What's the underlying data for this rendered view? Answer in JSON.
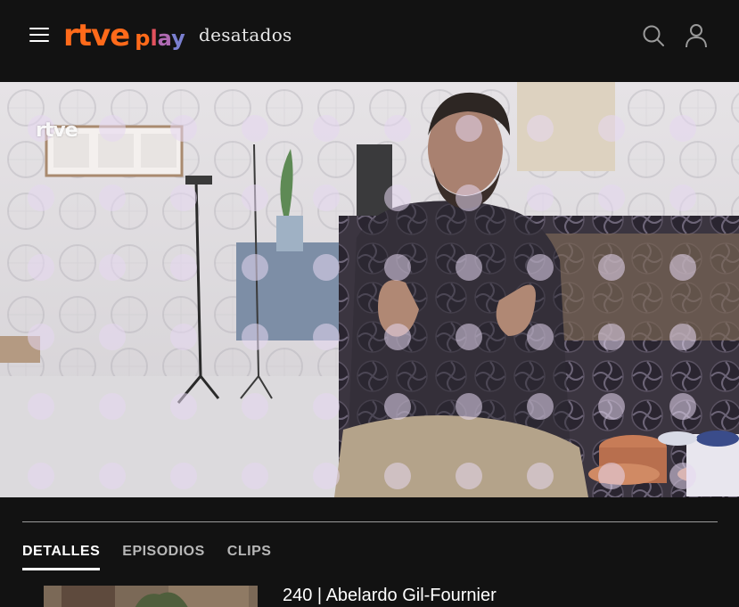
{
  "header": {
    "menu_icon": "hamburger-menu-icon",
    "logo": {
      "rtve": "rtve",
      "play": [
        "p",
        "l",
        "a",
        "y"
      ]
    },
    "section_title": "desatados",
    "search_icon": "search-icon",
    "user_icon": "user-icon"
  },
  "player": {
    "watermark": "rtve",
    "scene": "interview-video-frame"
  },
  "tabs": [
    {
      "label": "DETALLES",
      "active": true
    },
    {
      "label": "EPISODIOS",
      "active": false
    },
    {
      "label": "CLIPS",
      "active": false
    }
  ],
  "episode": {
    "title": "240 | Abelardo Gil-Fournier"
  },
  "colors": {
    "background": "#121212",
    "brand_orange": "#ff6a1a",
    "tab_active": "#ffffff",
    "tab_inactive": "#b7b7b7"
  }
}
